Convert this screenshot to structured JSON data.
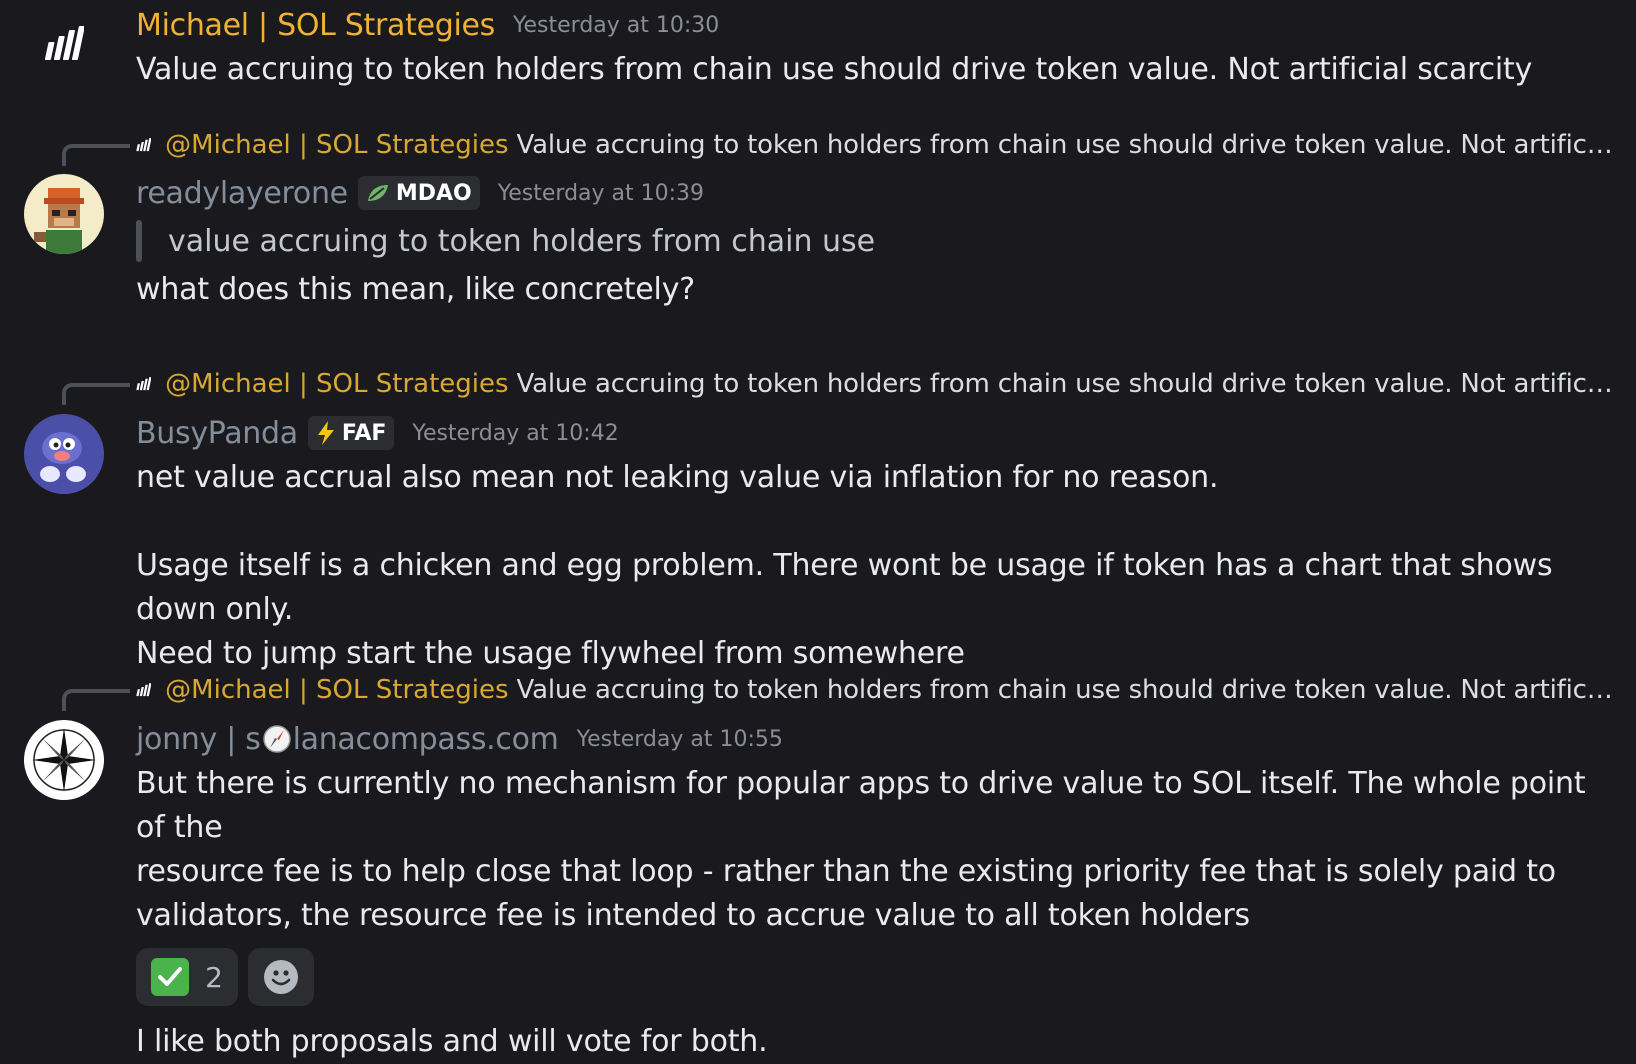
{
  "messages": [
    {
      "author": "Michael | SOL Strategies",
      "timestamp": "Yesterday at 10:30",
      "text": "Value accruing to token holders from chain use should drive token value. Not artificial scarcity"
    },
    {
      "reply_to": {
        "mention": "@Michael | SOL Strategies",
        "text": "Value accruing to token holders from chain use should drive token value. Not artificial sc..."
      },
      "author": "readylayerone",
      "tag": {
        "icon": "leaf-icon",
        "label": "MDAO"
      },
      "timestamp": "Yesterday at 10:39",
      "quote": "value accruing to token holders from chain use",
      "text": "what does this mean, like concretely?"
    },
    {
      "reply_to": {
        "mention": "@Michael | SOL Strategies",
        "text": "Value accruing to token holders from chain use should drive token value. Not artificial sc..."
      },
      "author": "BusyPanda",
      "tag": {
        "icon": "lightning-icon",
        "label": "FAF"
      },
      "timestamp": "Yesterday at 10:42",
      "text_lines": [
        "net value accrual also mean not leaking value via inflation for no reason.",
        "",
        "Usage itself is a chicken and egg problem. There wont be usage if token has a chart that shows down only.",
        "Need to jump start the usage flywheel from somewhere"
      ]
    },
    {
      "reply_to": {
        "mention": "@Michael | SOL Strategies",
        "text": "Value accruing to token holders from chain use should drive token value. Not artificial sc..."
      },
      "author_prefix": "jonny | s",
      "author_suffix": "lanacompass.com",
      "timestamp": "Yesterday at 10:55",
      "text_lines": [
        "But there is currently no mechanism for popular apps to drive value to SOL itself. The whole point of the",
        "resource fee is to help close that loop - rather than the existing priority fee that is solely paid to",
        "validators, the resource fee is intended to accrue value to all token holders"
      ],
      "reactions": [
        {
          "emoji": "check-mark-icon",
          "count": "2"
        }
      ],
      "add_reaction_icon": "smiley-icon",
      "followup": "I like both proposals and will vote for both."
    }
  ],
  "colors": {
    "background": "#1a1a1e",
    "gold_name": "#f0b232",
    "gray_name": "#848e9b",
    "mention": "#d9a832"
  }
}
